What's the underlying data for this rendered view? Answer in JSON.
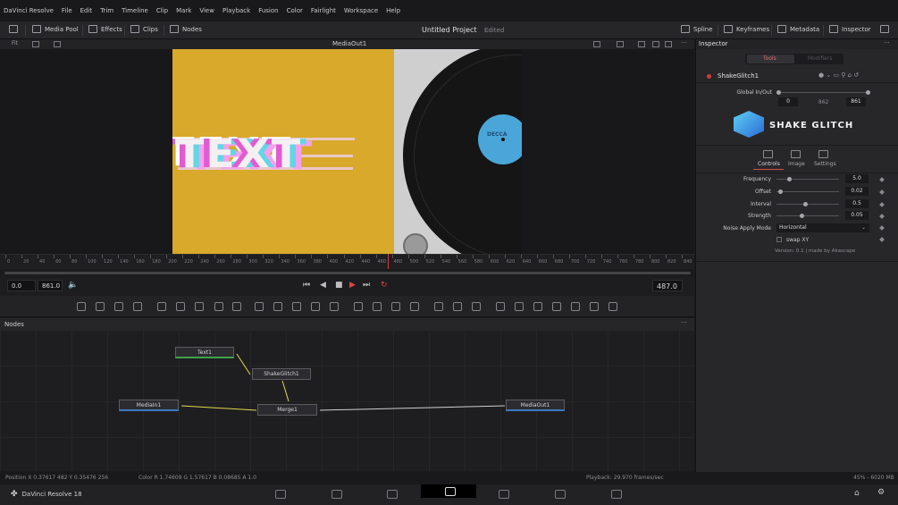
{
  "menu": [
    "DaVinci Resolve",
    "File",
    "Edit",
    "Trim",
    "Timeline",
    "Clip",
    "Mark",
    "View",
    "Playback",
    "Fusion",
    "Color",
    "Fairlight",
    "Workspace",
    "Help"
  ],
  "toolbar": {
    "media_pool": "Media Pool",
    "effects": "Effects",
    "clips": "Clips",
    "nodes": "Nodes",
    "project_title": "Untitled Project",
    "project_status": "Edited",
    "spline": "Spline",
    "keyframes": "Keyframes",
    "metadata": "Metadata",
    "inspector": "Inspector"
  },
  "viewer": {
    "title": "MediaOut1",
    "fit": "Fit",
    "overlay_text": "TEXT",
    "record_label": "DECCA"
  },
  "ruler": {
    "ticks": [
      "0",
      "20",
      "40",
      "60",
      "80",
      "100",
      "120",
      "140",
      "160",
      "180",
      "200",
      "220",
      "240",
      "260",
      "280",
      "300",
      "320",
      "340",
      "360",
      "380",
      "400",
      "420",
      "440",
      "460",
      "480",
      "500",
      "520",
      "540",
      "560",
      "580",
      "600",
      "620",
      "640",
      "660",
      "680",
      "700",
      "720",
      "740",
      "760",
      "780",
      "800",
      "820",
      "840"
    ],
    "playhead_frame": 487,
    "total_frames": 861
  },
  "transport": {
    "start": "0.0",
    "end": "861.0",
    "current": "487.0"
  },
  "nodes": {
    "title": "Nodes",
    "items": [
      {
        "name": "Text1"
      },
      {
        "name": "ShakeGlitch1"
      },
      {
        "name": "MediaIn1"
      },
      {
        "name": "Merge1"
      },
      {
        "name": "MediaOut1"
      }
    ]
  },
  "status": {
    "position": "Position  X 0.37617    482    Y 0.35476    256",
    "color": "Color R 1.74609    G 1.57617    B 0.08685    A 1.0",
    "playback": "Playback: 29.970 frames/sec",
    "memory": "45% - 6020 MB"
  },
  "brand": "DaVinci Resolve 18",
  "inspector": {
    "title": "Inspector",
    "tab_tools": "Tools",
    "tab_modifiers": "Modifiers",
    "tool_name": "ShakeGlitch1",
    "global_label": "Global In/Out",
    "global_in": "0",
    "global_mid": "862",
    "global_out": "861",
    "logo_text": "SHAKE GLITCH",
    "subtabs": [
      "Controls",
      "Image",
      "Settings"
    ],
    "params": [
      {
        "label": "Frequency",
        "value": "5.0",
        "fraction": 0.2
      },
      {
        "label": "Offset",
        "value": "0.02",
        "fraction": 0.05
      },
      {
        "label": "Interval",
        "value": "0.5",
        "fraction": 0.45
      },
      {
        "label": "Strength",
        "value": "0.05",
        "fraction": 0.4
      }
    ],
    "noise_label": "Noise Apply Mode",
    "noise_value": "Horizontal",
    "swap_label": "swap XY",
    "version": "Version: 0.1 | made by Akascape"
  },
  "colors": {
    "accent": "#d33b3b",
    "background": "#1b1b1d",
    "yellow": "#d8a92a",
    "record_label": "#4aa6d8"
  }
}
